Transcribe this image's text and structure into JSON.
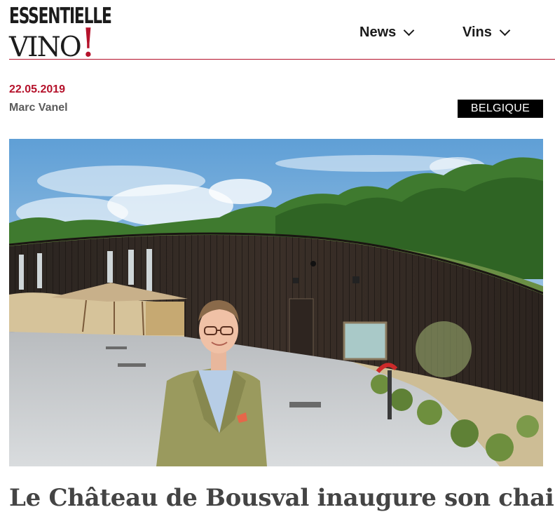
{
  "header": {
    "logo_top": "ESSENTIELLE",
    "logo_bottom": "VINO",
    "logo_bang": "!",
    "nav": [
      {
        "label": "News"
      },
      {
        "label": "Vins"
      }
    ]
  },
  "article": {
    "date": "22.05.2019",
    "author": "Marc Vanel",
    "category": "BELGIQUE",
    "title": "Le Château de Bousval inaugure son chai"
  },
  "colors": {
    "accent": "#b5122b",
    "badge_bg": "#000000",
    "text_dark": "#1a1a1a",
    "text_muted": "#5a5a5a"
  }
}
